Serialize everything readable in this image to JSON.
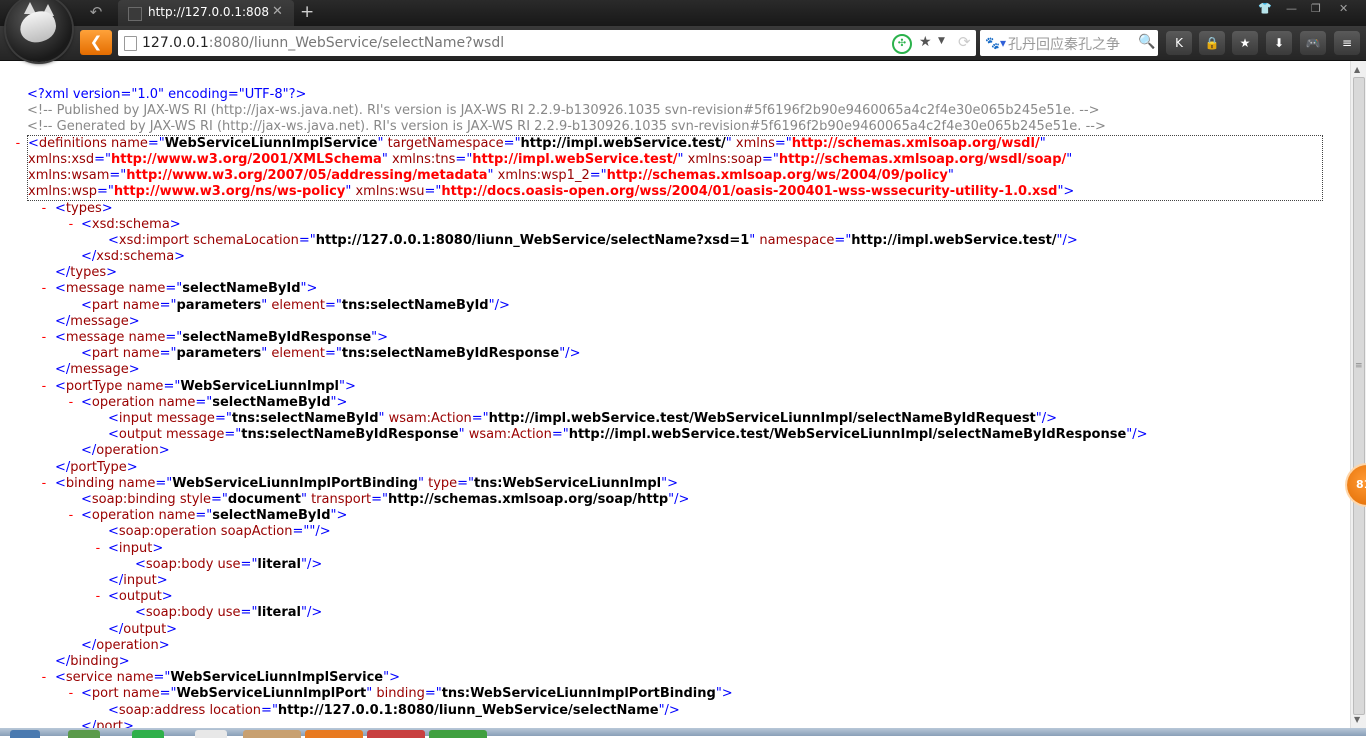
{
  "browser": {
    "tab_title": "http://127.0.0.1:808",
    "new_tab": "+",
    "url_host": "127.0.0.1",
    "url_rest": ":8080/liunn_WebService/selectName?wsdl",
    "search_placeholder": "孔丹回应秦孔之争",
    "toolbar_buttons": [
      "K",
      "lock",
      "star",
      "download",
      "gamepad",
      "more"
    ],
    "badge": "81"
  },
  "xml": {
    "decl": "<?xml version=\"1.0\" encoding=\"UTF-8\"?>",
    "comment1": "<!-- Published by JAX-WS RI (http://jax-ws.java.net). RI's version is JAX-WS RI 2.2.9-b130926.1035 svn-revision#5f6196f2b90e9460065a4c2f4e30e065b245e51e. -->",
    "comment2": "<!-- Generated by JAX-WS RI (http://jax-ws.java.net). RI's version is JAX-WS RI 2.2.9-b130926.1035 svn-revision#5f6196f2b90e9460065a4c2f4e30e065b245e51e. -->",
    "def_name": "WebServiceLiunnImplService",
    "def_tns": "http://impl.webService.test/",
    "ns_xmlns": "http://schemas.xmlsoap.org/wsdl/",
    "ns_xsd": "http://www.w3.org/2001/XMLSchema",
    "ns_tns": "http://impl.webService.test/",
    "ns_soap": "http://schemas.xmlsoap.org/wsdl/soap/",
    "ns_wsam": "http://www.w3.org/2007/05/addressing/metadata",
    "ns_wsp1_2": "http://schemas.xmlsoap.org/ws/2004/09/policy",
    "ns_wsp": "http://www.w3.org/ns/ws-policy",
    "ns_wsu": "http://docs.oasis-open.org/wss/2004/01/oasis-200401-wss-wssecurity-utility-1.0.xsd",
    "schema_location": "http://127.0.0.1:8080/liunn_WebService/selectName?xsd=1",
    "import_namespace": "http://impl.webService.test/",
    "msg1_name": "selectNameById",
    "part_name": "parameters",
    "msg1_element": "tns:selectNameById",
    "msg2_name": "selectNameByIdResponse",
    "msg2_element": "tns:selectNameByIdResponse",
    "porttype_name": "WebServiceLiunnImpl",
    "op_name": "selectNameById",
    "input_message": "tns:selectNameById",
    "input_action": "http://impl.webService.test/WebServiceLiunnImpl/selectNameByIdRequest",
    "output_message": "tns:selectNameByIdResponse",
    "output_action": "http://impl.webService.test/WebServiceLiunnImpl/selectNameByIdResponse",
    "binding_name": "WebServiceLiunnImplPortBinding",
    "binding_type": "tns:WebServiceLiunnImpl",
    "soap_style": "document",
    "soap_transport": "http://schemas.xmlsoap.org/soap/http",
    "soap_action": "",
    "body_use": "literal",
    "service_name": "WebServiceLiunnImplService",
    "port_name": "WebServiceLiunnImplPort",
    "port_binding": "tns:WebServiceLiunnImplPortBinding",
    "address_location": "http://127.0.0.1:8080/liunn_WebService/selectName"
  }
}
